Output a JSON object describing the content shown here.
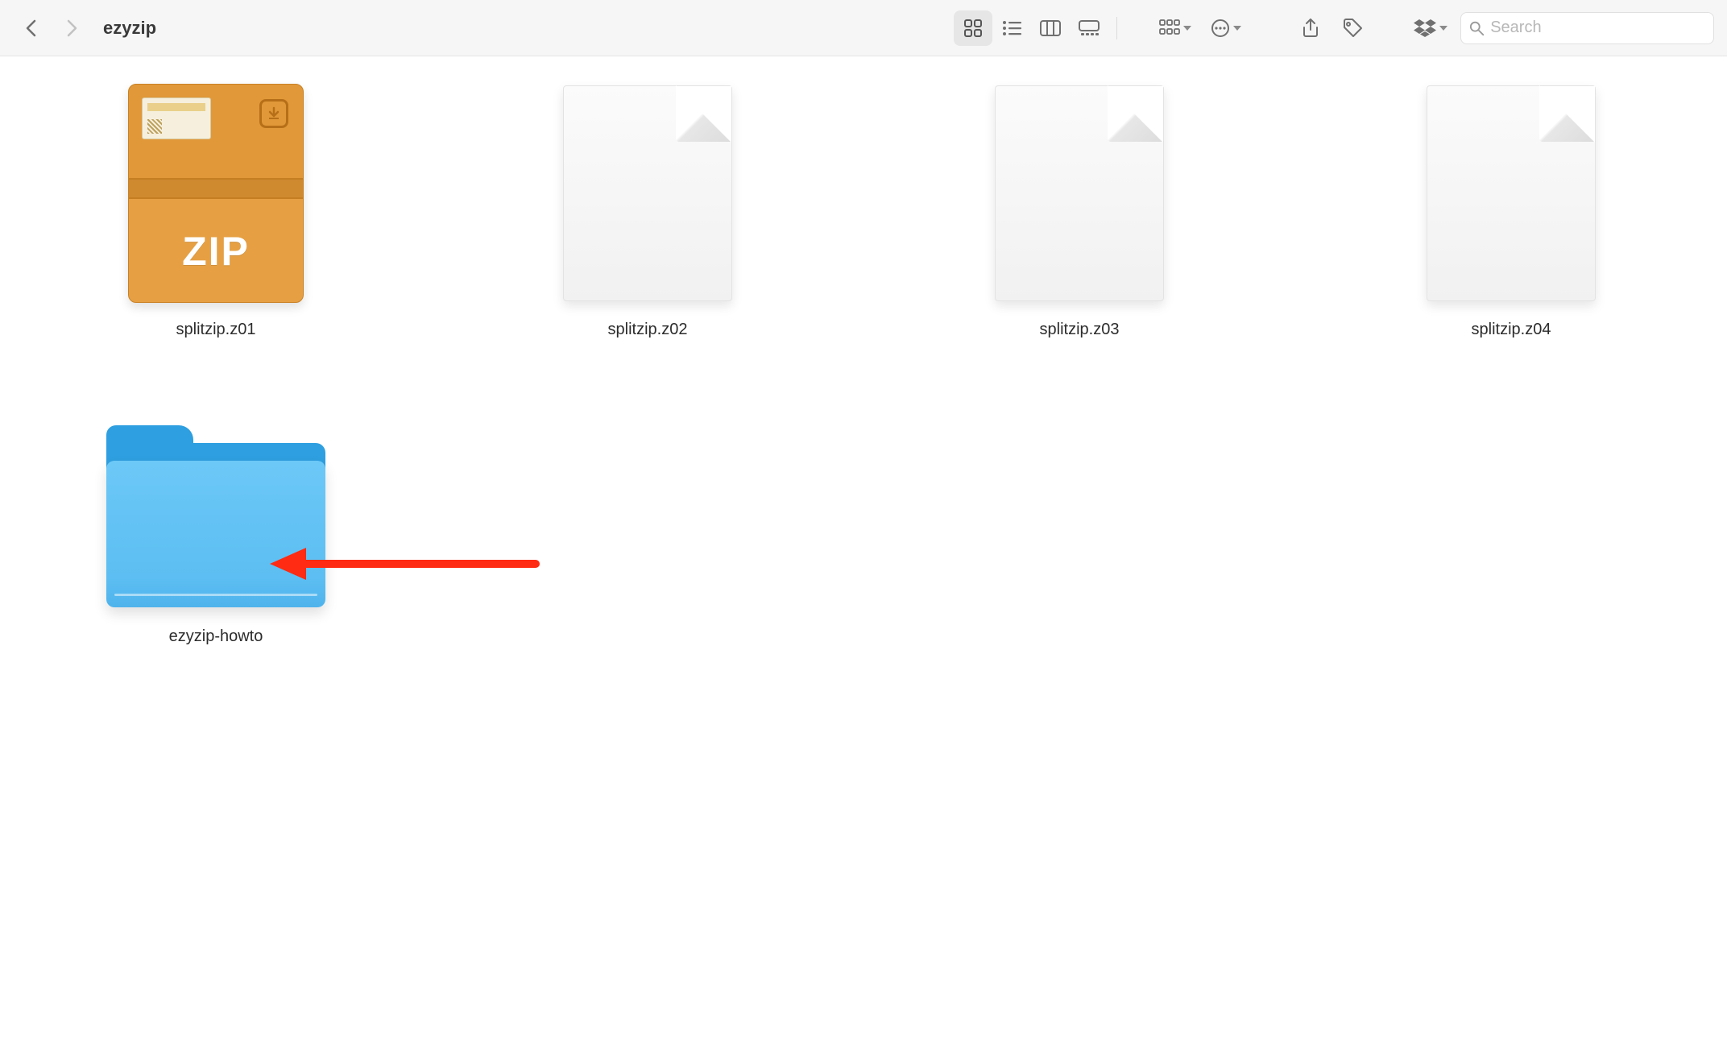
{
  "toolbar": {
    "title": "ezyzip",
    "search_placeholder": "Search",
    "icons": {
      "back": "chevron-left",
      "forward": "chevron-right",
      "view_icon": "grid",
      "view_list": "list",
      "view_column": "columns",
      "view_gallery": "gallery",
      "group": "group-by",
      "action": "ellipsis-circle",
      "share": "share",
      "tag": "tag",
      "dropbox": "dropbox",
      "search": "magnifier"
    }
  },
  "items": [
    {
      "name": "splitzip.z01",
      "type": "zip",
      "zip_label": "ZIP"
    },
    {
      "name": "splitzip.z02",
      "type": "document"
    },
    {
      "name": "splitzip.z03",
      "type": "document"
    },
    {
      "name": "splitzip.z04",
      "type": "document"
    },
    {
      "name": "ezyzip-howto",
      "type": "folder"
    }
  ],
  "annotation": {
    "arrow_color": "#ff2b12"
  }
}
